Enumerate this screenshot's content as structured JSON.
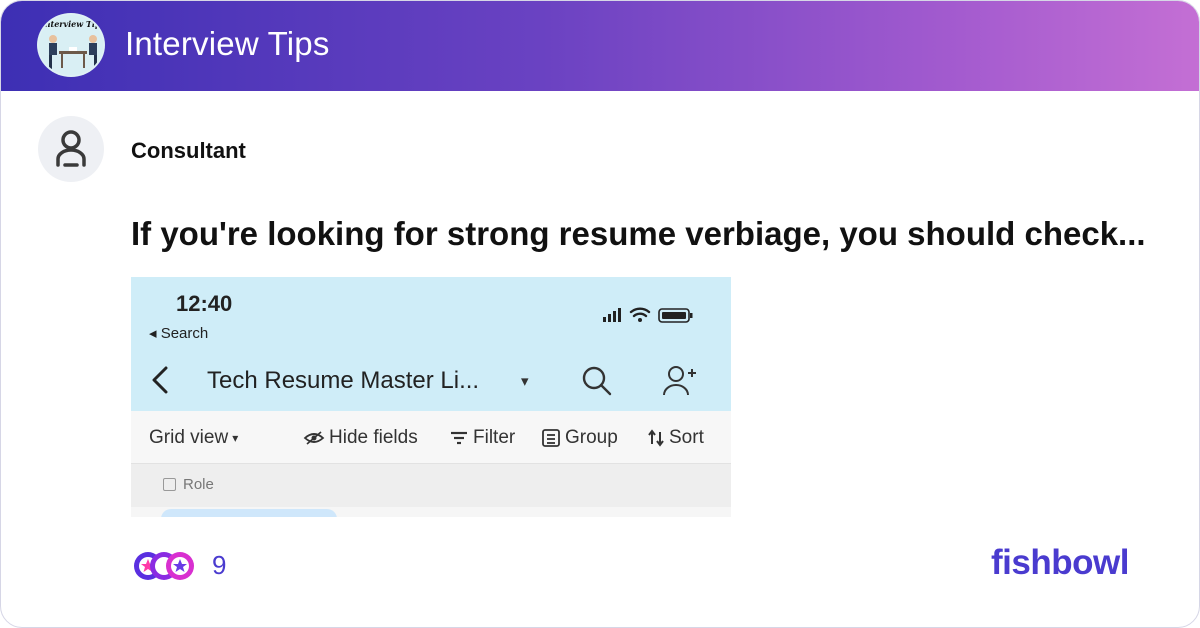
{
  "group": {
    "name": "Interview Tips",
    "avatar_text": "Interview Tips"
  },
  "author": {
    "name": "Consultant",
    "icon": "person-icon"
  },
  "post": {
    "title": "If you're looking for strong resume verbiage, you should check..."
  },
  "screenshot": {
    "time": "12:40",
    "back_label": "◂ Search",
    "base_title": "Tech Resume Master Li...",
    "caret": "▾",
    "toolbar": {
      "grid_view": "Grid view",
      "grid_caret": "▾",
      "hide_fields": "Hide fields",
      "filter": "Filter",
      "group": "Group",
      "sort": "Sort"
    },
    "field_label": "Role"
  },
  "reactions": {
    "count": "9"
  },
  "brand": {
    "name": "fishbowl"
  },
  "colors": {
    "brand": "#4a3bcf",
    "header_start": "#3d2fb4",
    "header_end": "#c46fd4"
  }
}
